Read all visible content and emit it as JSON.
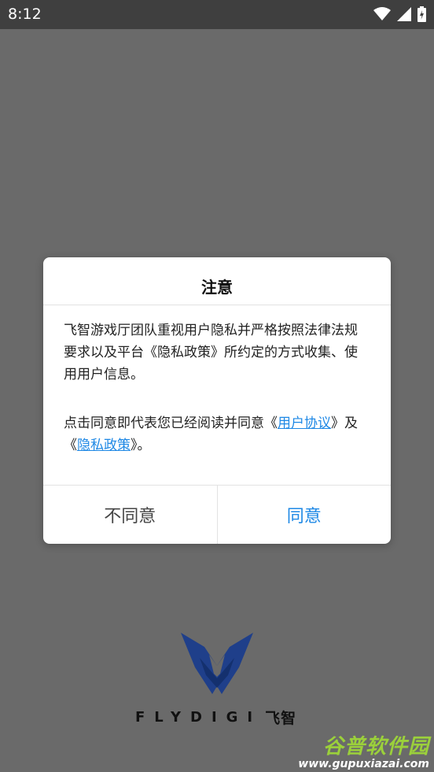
{
  "status_bar": {
    "time": "8:12"
  },
  "dialog": {
    "title": "注意",
    "paragraph1": "飞智游戏厅团队重视用户隐私并严格按照法律法规要求以及平台《隐私政策》所约定的方式收集、使用用户信息。",
    "paragraph2_prefix": "点击同意即代表您已经阅读并同意《",
    "link_user_agreement": "用户协议",
    "paragraph2_mid": "》及《",
    "link_privacy_policy": "隐私政策",
    "paragraph2_suffix": "》。",
    "button_disagree": "不同意",
    "button_agree": "同意"
  },
  "brand": {
    "name_en": "FLYDIGI",
    "name_cn": "飞智"
  },
  "watermark": {
    "title": "谷普软件园",
    "url": "www.gupuxiazai.com"
  },
  "colors": {
    "accent": "#1e88e5",
    "overlay": "#6a6a6a",
    "logo": "#1f3f8a"
  }
}
